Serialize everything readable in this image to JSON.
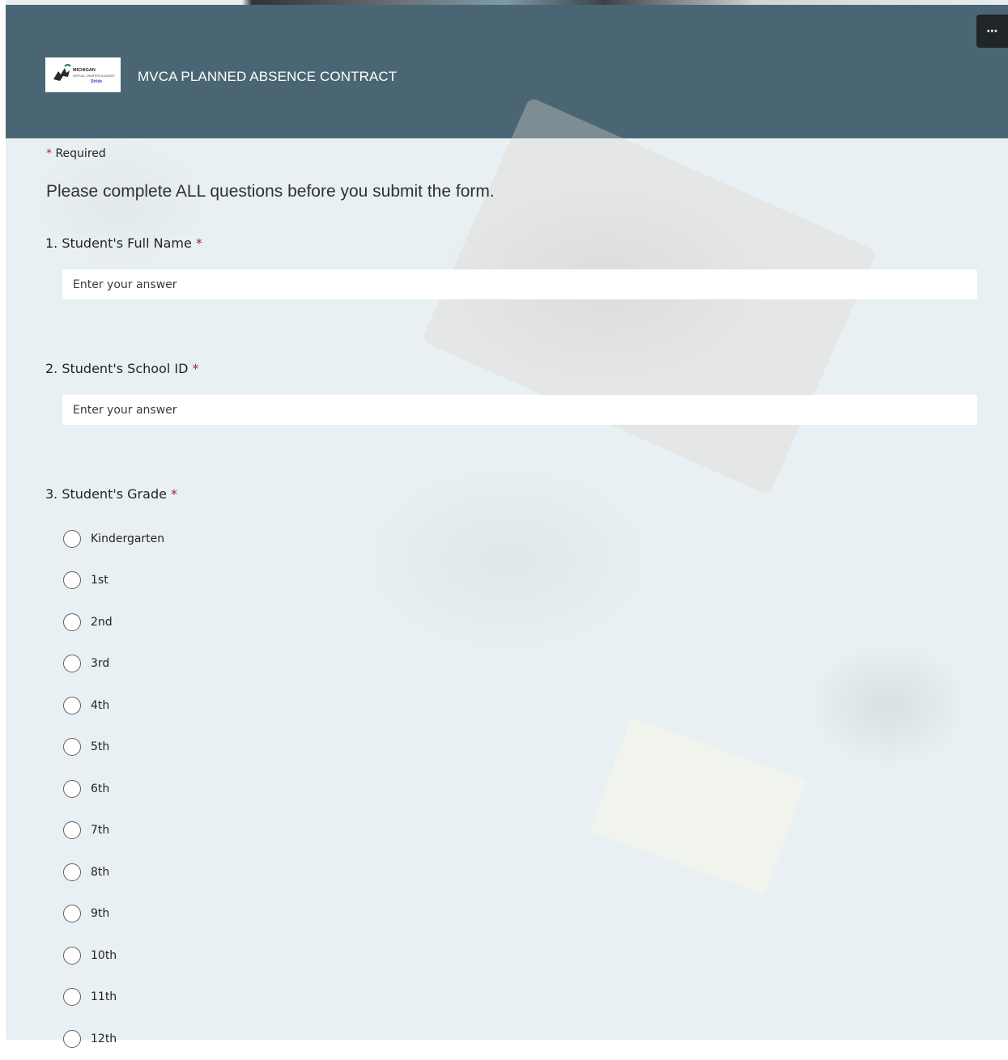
{
  "header": {
    "title": "MVCA PLANNED ABSENCE CONTRACT",
    "logo_text": [
      "MICHIGAN",
      "VIRTUAL CHARTER ACADEMY",
      "Stride"
    ],
    "more_label": "⋯"
  },
  "required_label": "Required",
  "intro_text": "Please complete ALL questions before you submit the form.",
  "questions": [
    {
      "title": "1. Student's Full Name",
      "placeholder": "Enter your answer"
    },
    {
      "title": "2. Student's School ID",
      "placeholder": "Enter your answer"
    },
    {
      "title": "3. Student's Grade",
      "options": [
        "Kindergarten",
        "1st",
        "2nd",
        "3rd",
        "4th",
        "5th",
        "6th",
        "7th",
        "8th",
        "9th",
        "10th",
        "11th",
        "12th"
      ]
    }
  ],
  "asterisk": "*",
  "colors": {
    "header": "#4a6674",
    "required": "#a4262c",
    "body_bg": "#e9f0f3"
  }
}
